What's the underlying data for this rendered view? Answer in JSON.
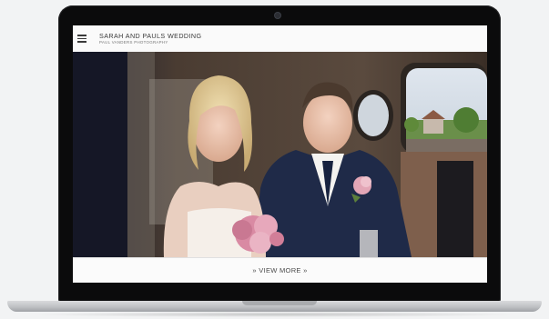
{
  "site": {
    "title": "SARAH AND PAULS WEDDING",
    "subtitle": "PAUL VANDERS PHOTOGRAPHY"
  },
  "hero": {
    "view_more_label": "» VIEW MORE »"
  },
  "colors": {
    "laptop_bezel": "#0b0b0c",
    "page_background": "#f2f3f4",
    "header_background": "#fafafa",
    "suit_navy": "#1f2a48"
  },
  "icons": [
    "menu-icon",
    "camera-icon"
  ]
}
